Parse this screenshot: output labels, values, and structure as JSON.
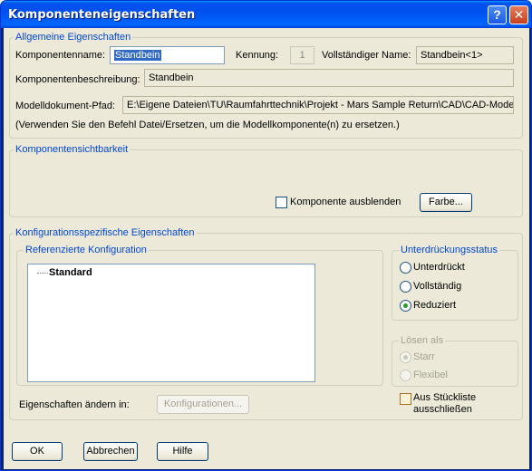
{
  "window": {
    "title": "Komponenteneigenschaften",
    "help_glyph": "?",
    "close_glyph": "✕"
  },
  "general": {
    "group_label": "Allgemeine Eigenschaften",
    "component_name_label": "Komponentenname:",
    "component_name_value": "Standbein",
    "id_label": "Kennung:",
    "id_value": "1",
    "full_name_label": "Vollständiger Name:",
    "full_name_value": "Standbein<1>",
    "description_label": "Komponentenbeschreibung:",
    "description_value": "Standbein",
    "model_path_label": "Modelldokument-Pfad:",
    "model_path_value": "E:\\Eigene Dateien\\TU\\Raumfahrttechnik\\Projekt - Mars Sample Return\\CAD\\CAD-Modell-",
    "hint_text": "(Verwenden Sie den Befehl Datei/Ersetzen, um die Modellkomponente(n) zu ersetzen.)"
  },
  "visibility": {
    "group_label": "Komponentensichtbarkeit",
    "hide_label": "Komponente ausblenden",
    "hide_checked": false,
    "color_button": "Farbe..."
  },
  "config": {
    "group_label": "Konfigurationsspezifische Eigenschaften",
    "ref_group_label": "Referenzierte Konfiguration",
    "tree_items": [
      "Standard"
    ],
    "change_in_label": "Eigenschaften ändern in:",
    "configurations_button": "Konfigurationen...",
    "suppression": {
      "group_label": "Unterdrückungsstatus",
      "options": [
        "Unterdrückt",
        "Vollständig",
        "Reduziert"
      ],
      "selected": "Reduziert"
    },
    "solve_as": {
      "group_label": "Lösen als",
      "options": [
        "Starr",
        "Flexibel"
      ],
      "selected": "Starr"
    },
    "exclude_bom_label_line1": "Aus Stückliste",
    "exclude_bom_label_line2": "ausschließen",
    "exclude_bom_checked": false
  },
  "buttons": {
    "ok": "OK",
    "cancel": "Abbrechen",
    "help": "Hilfe"
  },
  "colors": {
    "group_label": "#0046d5",
    "selection": "#316ac5",
    "title_bar": "#0053ee",
    "dialog_bg": "#ece9d8"
  }
}
